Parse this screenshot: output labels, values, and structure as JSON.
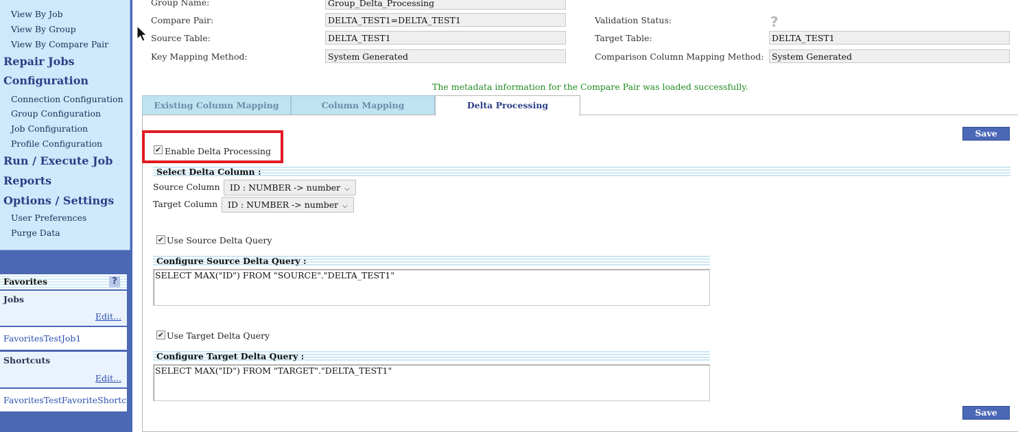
{
  "nav": {
    "items_top": [
      "View By Job",
      "View By Group",
      "View By Compare Pair"
    ],
    "repair_jobs": "Repair Jobs",
    "configuration": "Configuration",
    "config_items": [
      "Connection Configuration",
      "Group Configuration",
      "Job Configuration",
      "Profile Configuration"
    ],
    "run_execute": "Run / Execute Job",
    "reports": "Reports",
    "options_settings": "Options / Settings",
    "options_items": [
      "User Preferences",
      "Purge Data"
    ]
  },
  "favorites": {
    "title": "Favorites",
    "help": "?",
    "jobs_label": "Jobs",
    "jobs_edit": "Edit...",
    "jobs_item": "FavoritesTestJob1",
    "shortcuts_label": "Shortcuts",
    "shortcuts_edit": "Edit...",
    "shortcuts_item": "FavoritesTestFavoriteShortcut"
  },
  "form": {
    "group_name_label": "Group Name:",
    "group_name_value": "Group_Delta_Processing",
    "compare_pair_label": "Compare Pair:",
    "compare_pair_value": "DELTA_TEST1=DELTA_TEST1",
    "validation_status_label": "Validation Status:",
    "validation_status_icon": "?",
    "source_table_label": "Source Table:",
    "source_table_value": "DELTA_TEST1",
    "target_table_label": "Target Table:",
    "target_table_value": "DELTA_TEST1",
    "key_mapping_label": "Key Mapping Method:",
    "key_mapping_value": "System Generated",
    "comparison_mapping_label": "Comparison Column Mapping Method:",
    "comparison_mapping_value": "System Generated"
  },
  "message": "The metadata information for the Compare Pair was loaded successfully.",
  "tabs": [
    {
      "label": "Existing Column Mapping",
      "active": false
    },
    {
      "label": "Column Mapping",
      "active": false
    },
    {
      "label": "Delta Processing",
      "active": true
    }
  ],
  "delta": {
    "save_label": "Save",
    "enable_label": "Enable Delta Processing",
    "enable_checked": true,
    "select_delta_header": "Select Delta Column :",
    "source_column_label": "Source Column :",
    "source_column_value": "ID : NUMBER -> number",
    "target_column_label": "Target Column :",
    "target_column_value": "ID : NUMBER -> number",
    "use_source_label": "Use Source Delta Query",
    "use_source_checked": true,
    "source_query_header": "Configure Source Delta Query :",
    "source_query_value": "SELECT MAX(\"ID\") FROM \"SOURCE\".\"DELTA_TEST1\"",
    "use_target_label": "Use Target Delta Query",
    "use_target_checked": true,
    "target_query_header": "Configure Target Delta Query :",
    "target_query_value": "SELECT MAX(\"ID\") FROM \"TARGET\".\"DELTA_TEST1\"",
    "check_glyph": "✔"
  },
  "colors": {
    "nav_bg": "#cde9fb",
    "nav_dark": "#4a68b4",
    "save_bg": "#4b68b6",
    "highlight": "#e01b24",
    "success": "#1f8a1f"
  }
}
